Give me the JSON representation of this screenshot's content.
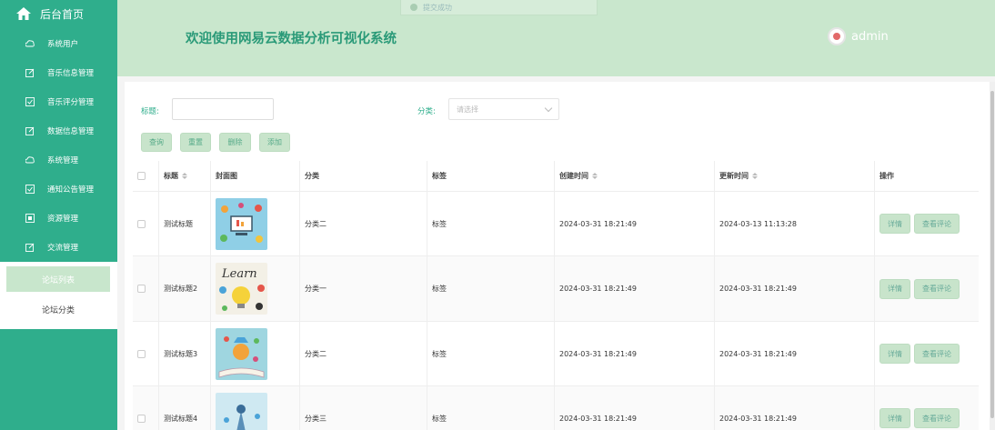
{
  "sidebar": {
    "home_label": "后台首页",
    "items": [
      {
        "label": "系统用户",
        "icon": "cloud-icon"
      },
      {
        "label": "音乐信息管理",
        "icon": "edit-icon"
      },
      {
        "label": "音乐评分管理",
        "icon": "check-square-icon"
      },
      {
        "label": "数据信息管理",
        "icon": "edit-icon"
      },
      {
        "label": "系统管理",
        "icon": "cloud-icon"
      },
      {
        "label": "通知公告管理",
        "icon": "check-square-icon"
      },
      {
        "label": "资源管理",
        "icon": "box-icon"
      },
      {
        "label": "交流管理",
        "icon": "edit-icon"
      }
    ],
    "submenu": {
      "active": "论坛列表",
      "other": "论坛分类"
    }
  },
  "header": {
    "title": "欢迎使用网易云数据分析可视化系统",
    "toast": "提交成功",
    "username": "admin"
  },
  "filters": {
    "title_label": "标题:",
    "category_label": "分类:",
    "category_placeholder": "请选择"
  },
  "buttons": {
    "query": "查询",
    "reset": "重置",
    "delete": "删除",
    "add": "添加"
  },
  "table": {
    "headers": [
      "标题",
      "封面图",
      "分类",
      "标签",
      "创建时间",
      "更新时间",
      "操作"
    ],
    "rows": [
      {
        "title": "测试标题",
        "category": "分类二",
        "tag": "标签",
        "created": "2024-03-31 18:21:49",
        "updated": "2024-03-13 11:13:28",
        "detail": "详情",
        "comments": "查看评论"
      },
      {
        "title": "测试标题2",
        "category": "分类一",
        "tag": "标签",
        "created": "2024-03-31 18:21:49",
        "updated": "2024-03-31 18:21:49",
        "detail": "详情",
        "comments": "查看评论"
      },
      {
        "title": "测试标题3",
        "category": "分类二",
        "tag": "标签",
        "created": "2024-03-31 18:21:49",
        "updated": "2024-03-31 18:21:49",
        "detail": "详情",
        "comments": "查看评论"
      },
      {
        "title": "测试标题4",
        "category": "分类三",
        "tag": "标签",
        "created": "2024-03-31 18:21:49",
        "updated": "2024-03-31 18:21:49",
        "detail": "详情",
        "comments": "查看评论"
      }
    ]
  },
  "colors": {
    "accent": "#2fae8c",
    "header_bg": "#c9e7cd",
    "button_bg": "#c8e4cb"
  }
}
